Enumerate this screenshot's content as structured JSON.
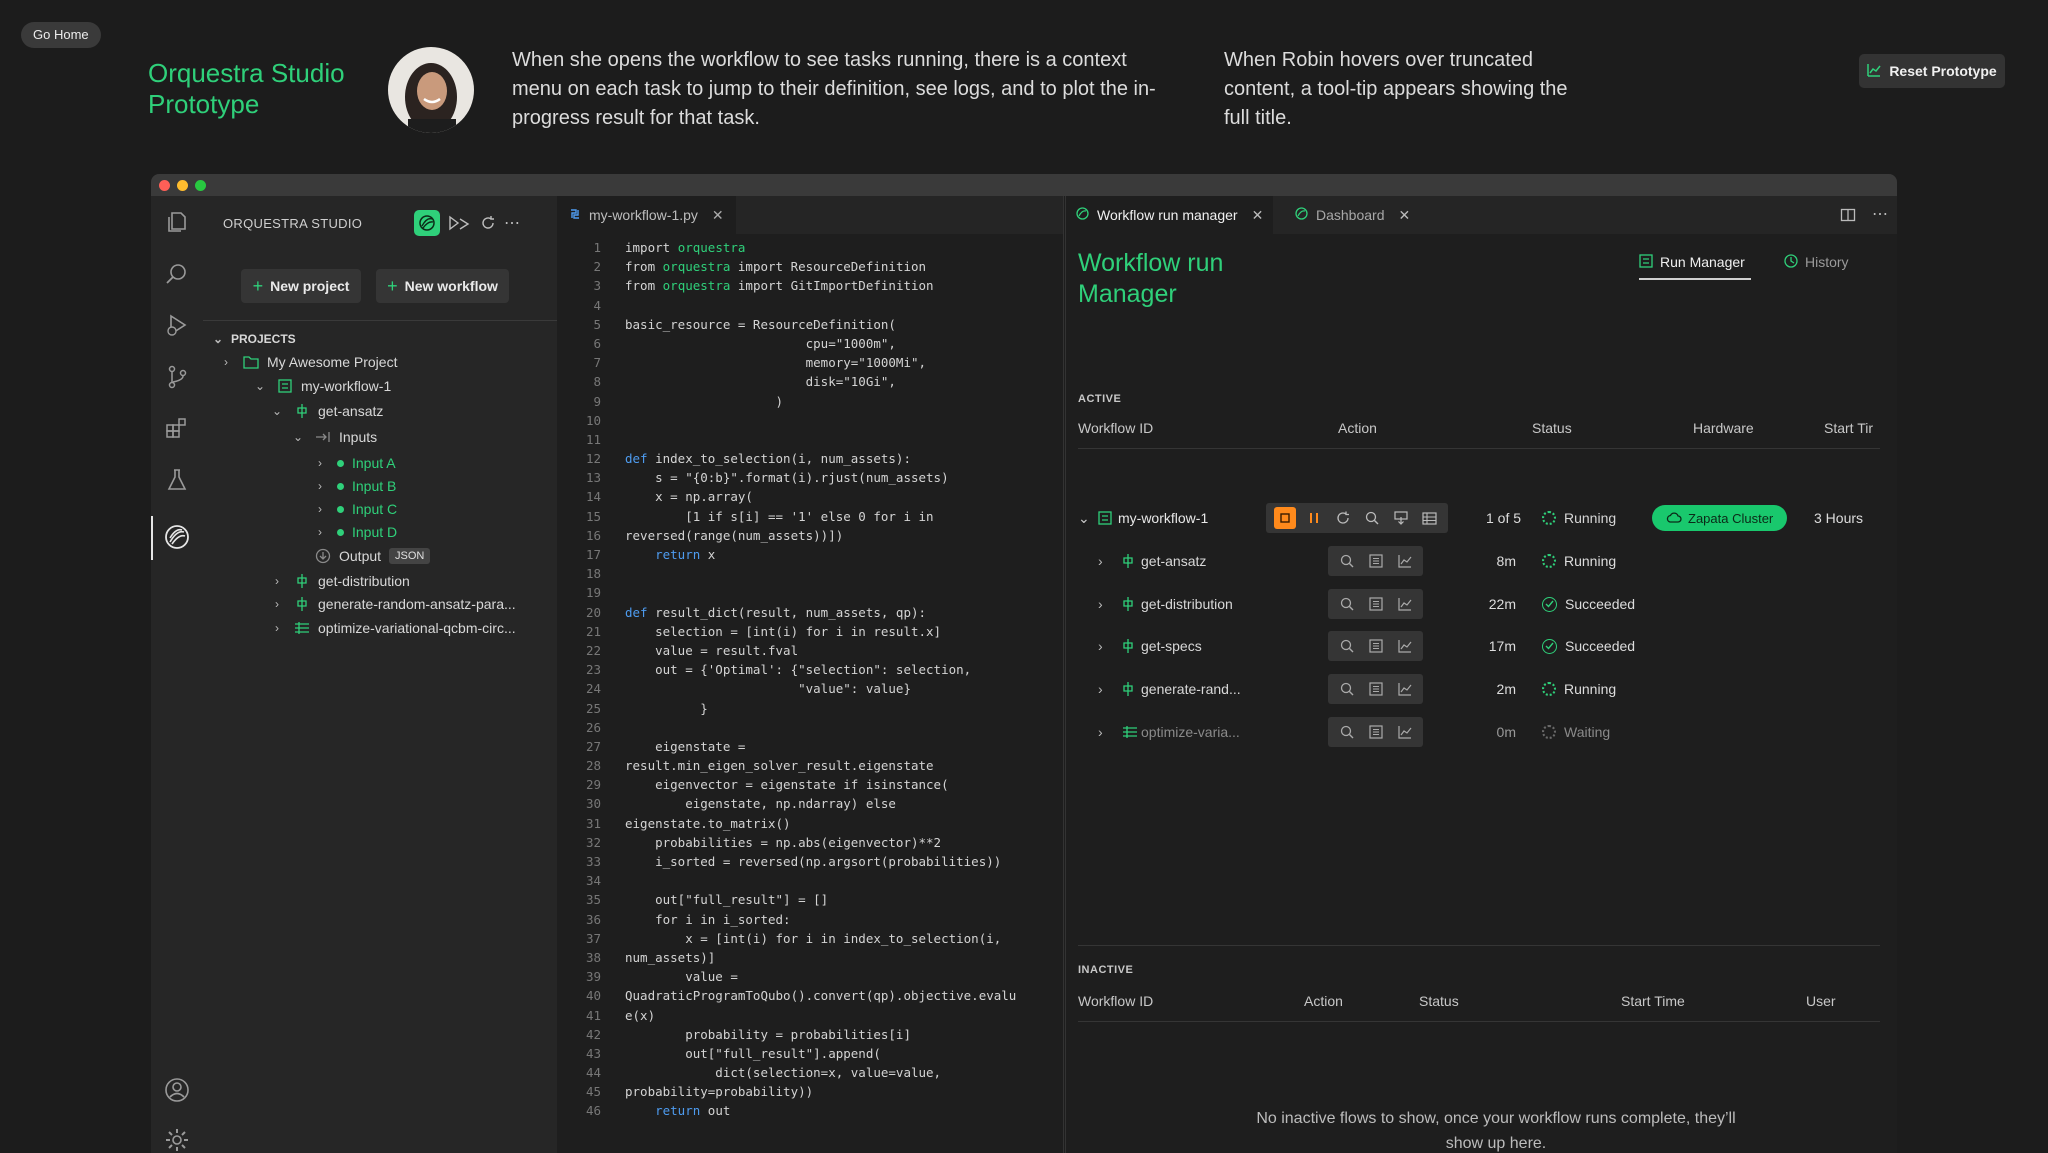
{
  "banner": {
    "go_home": "Go Home",
    "prototype_title": "Orquestra Studio Prototype",
    "description_1": "When she opens the workflow to see tasks running, there is a context menu on each task to jump to their definition, see logs, and to plot the in-progress result for that task.",
    "description_2": "When Robin hovers over truncated content, a tool-tip appears showing the full title.",
    "reset_button": "Reset Prototype"
  },
  "sidebar": {
    "title": "ORQUESTRA STUDIO",
    "new_project": "New project",
    "new_workflow": "New workflow",
    "projects_header": "PROJECTS",
    "tree": {
      "project": "My Awesome Project",
      "workflow": "my-workflow-1",
      "task_1": "get-ansatz",
      "inputs": "Inputs",
      "input_a": "Input A",
      "input_b": "Input B",
      "input_c": "Input C",
      "input_d": "Input D",
      "output": "Output",
      "output_badge": "JSON",
      "task_2": "get-distribution",
      "task_3": "generate-random-ansatz-para...",
      "task_4": "optimize-variational-qcbm-circ..."
    }
  },
  "editor": {
    "tab": "my-workflow-1.py",
    "lines": [
      "import orquestra",
      "from orquestra import ResourceDefinition",
      "from orquestra import GitImportDefinition",
      "",
      "basic_resource = ResourceDefinition(",
      "                        cpu=\"1000m\",",
      "                        memory=\"1000Mi\",",
      "                        disk=\"10Gi\",",
      "                    )",
      "",
      "",
      "def index_to_selection(i, num_assets):",
      "    s = \"{0:b}\".format(i).rjust(num_assets)",
      "    x = np.array(",
      "        [1 if s[i] == '1' else 0 for i in",
      "reversed(range(num_assets))])",
      "    return x",
      "",
      "",
      "def result_dict(result, num_assets, qp):",
      "    selection = [int(i) for i in result.x]",
      "    value = result.fval",
      "    out = {'Optimal': {\"selection\": selection,",
      "                       \"value\": value}",
      "          }",
      "",
      "    eigenstate =",
      "result.min_eigen_solver_result.eigenstate",
      "    eigenvector = eigenstate if isinstance(",
      "        eigenstate, np.ndarray) else",
      "eigenstate.to_matrix()",
      "    probabilities = np.abs(eigenvector)**2",
      "    i_sorted = reversed(np.argsort(probabilities))",
      "",
      "    out[\"full_result\"] = []",
      "    for i in i_sorted:",
      "        x = [int(i) for i in index_to_selection(i,",
      "num_assets)]",
      "        value =",
      "QuadraticProgramToQubo().convert(qp).objective.evalu",
      "e(x)",
      "        probability = probabilities[i]",
      "        out[\"full_result\"].append(",
      "            dict(selection=x, value=value,",
      "probability=probability))",
      "    return out"
    ]
  },
  "panel": {
    "tab_run_manager": "Workflow run manager",
    "tab_dashboard": "Dashboard",
    "title": "Workflow run Manager",
    "tab_run": "Run Manager",
    "tab_history": "History",
    "active_label": "ACTIVE",
    "inactive_label": "INACTIVE",
    "active_headers": {
      "workflow_id": "Workflow ID",
      "action": "Action",
      "status": "Status",
      "hardware": "Hardware",
      "start_time": "Start Tir"
    },
    "workflow_row": {
      "name": "my-workflow-1",
      "progress": "1 of 5",
      "status": "Running",
      "hardware": "Zapata Cluster",
      "start_time": "3 Hours"
    },
    "tasks": [
      {
        "name": "get-ansatz",
        "duration": "8m",
        "status": "Running"
      },
      {
        "name": "get-distribution",
        "duration": "22m",
        "status": "Succeeded"
      },
      {
        "name": "get-specs",
        "duration": "17m",
        "status": "Succeeded"
      },
      {
        "name": "generate-rand...",
        "duration": "2m",
        "status": "Running"
      },
      {
        "name": "optimize-varia...",
        "duration": "0m",
        "status": "Waiting"
      }
    ],
    "inactive_headers": {
      "workflow_id": "Workflow ID",
      "action": "Action",
      "status": "Status",
      "start_time": "Start Time",
      "user": "User"
    },
    "empty_message": "No inactive flows to show, once your workflow runs complete, they’ll show up here."
  },
  "colors": {
    "accent_green": "#2fd07a",
    "stop_orange": "#ff8a1c",
    "keyword_blue": "#4e9cf0"
  }
}
